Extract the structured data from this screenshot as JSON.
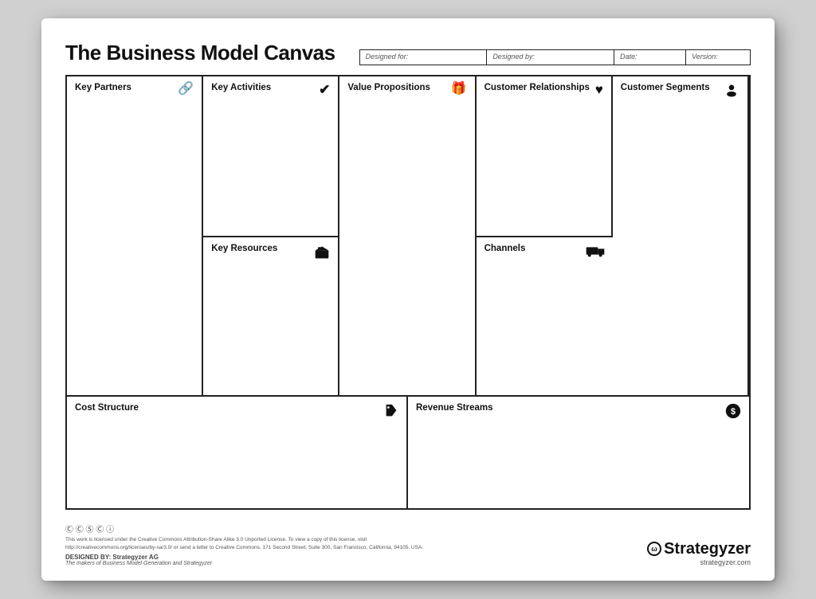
{
  "title": "The Business Model Canvas",
  "header": {
    "designed_for_label": "Designed for:",
    "designed_by_label": "Designed by:",
    "date_label": "Date:",
    "version_label": "Version:"
  },
  "cells": {
    "key_partners": {
      "title": "Key Partners",
      "icon": "🔗"
    },
    "key_activities": {
      "title": "Key Activities",
      "icon": "✔"
    },
    "key_resources": {
      "title": "Key Resources",
      "icon": "🏭"
    },
    "value_propositions": {
      "title": "Value Propositions",
      "icon": "🎁"
    },
    "customer_relationships": {
      "title": "Customer Relationships",
      "icon": "♥"
    },
    "channels": {
      "title": "Channels",
      "icon": "🚚"
    },
    "customer_segments": {
      "title": "Customer Segments",
      "icon": "👤"
    },
    "cost_structure": {
      "title": "Cost Structure",
      "icon": "🏷"
    },
    "revenue_streams": {
      "title": "Revenue Streams",
      "icon": "💲"
    }
  },
  "footer": {
    "cc_text": "This work is licensed under the Creative Commons Attribution-Share Alike 3.0 Unported License. To view a copy of this license, visit http://creativecommons.org/licenses/by-sa/3.0/ or send a letter to Creative Commons, 171 Second Street, Suite 300, San Francisco, California, 94105, USA.",
    "designed_by": "Strategyzer AG",
    "tagline": "The makers of Business Model Generation and Strategyzer",
    "brand_name": "Strategyzer",
    "brand_url": "strategyzer.com"
  }
}
